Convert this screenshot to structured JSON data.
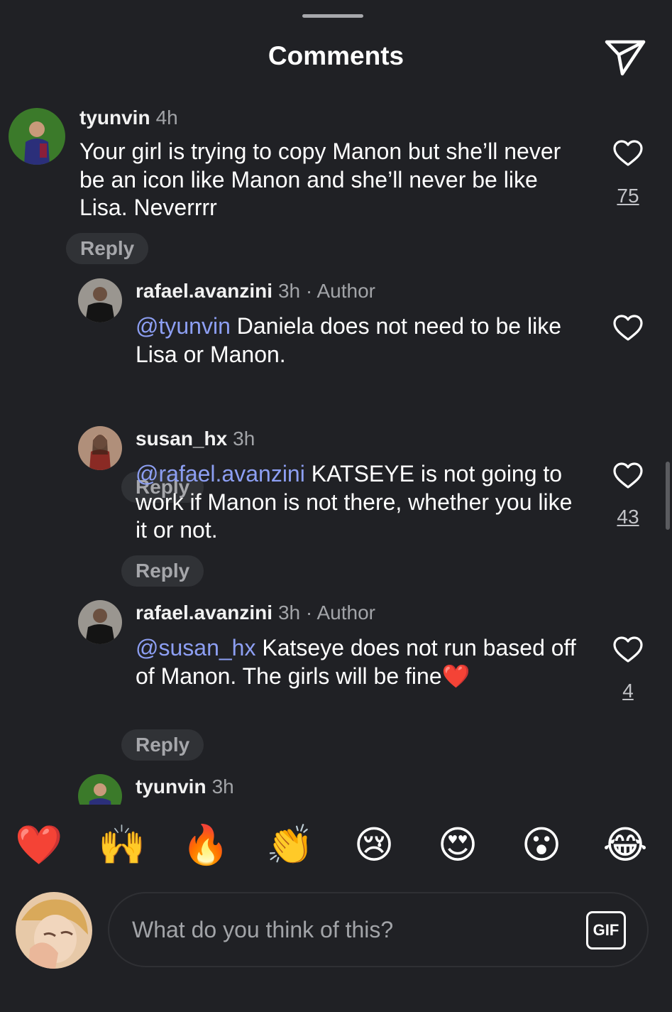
{
  "header": {
    "title": "Comments"
  },
  "comments": [
    {
      "username": "tyunvin",
      "time": "4h",
      "author_tag": "",
      "mention": "",
      "text": "Your girl is trying to copy Manon but she’ll never be an icon like Manon and she’ll never be like Lisa. Neverrrr",
      "reply_label": "Reply",
      "likes": "75"
    },
    {
      "username": "rafael.avanzini",
      "time": "3h",
      "author_tag": "· Author",
      "mention": "@tyunvin",
      "text": " Daniela does not need to be like Lisa or Manon.",
      "reply_label": "Reply",
      "likes": ""
    },
    {
      "username": "susan_hx",
      "time": "3h",
      "author_tag": "",
      "mention": "@rafael.avanzini",
      "text": " KATSEYE is not going to work if Manon is not there, whether you like it or not.",
      "reply_label": "Reply",
      "likes": "43"
    },
    {
      "username": "rafael.avanzini",
      "time": "3h",
      "author_tag": "· Author",
      "mention": "@susan_hx",
      "text": " Katseye does not run based off of Manon. The girls will be fine",
      "emoji": "❤️",
      "reply_label": "Reply",
      "likes": "4"
    },
    {
      "username": "tyunvin",
      "time": "3h",
      "author_tag": ""
    }
  ],
  "quick_reactions": [
    "❤️",
    "🙌",
    "🔥",
    "👏",
    "😢",
    "😍",
    "😮",
    "😂"
  ],
  "composer": {
    "placeholder": "What do you think of this?",
    "gif_label": "GIF"
  },
  "colors": {
    "background": "#202125",
    "mention": "#8d9ff3",
    "reply_pill": "#303236"
  }
}
